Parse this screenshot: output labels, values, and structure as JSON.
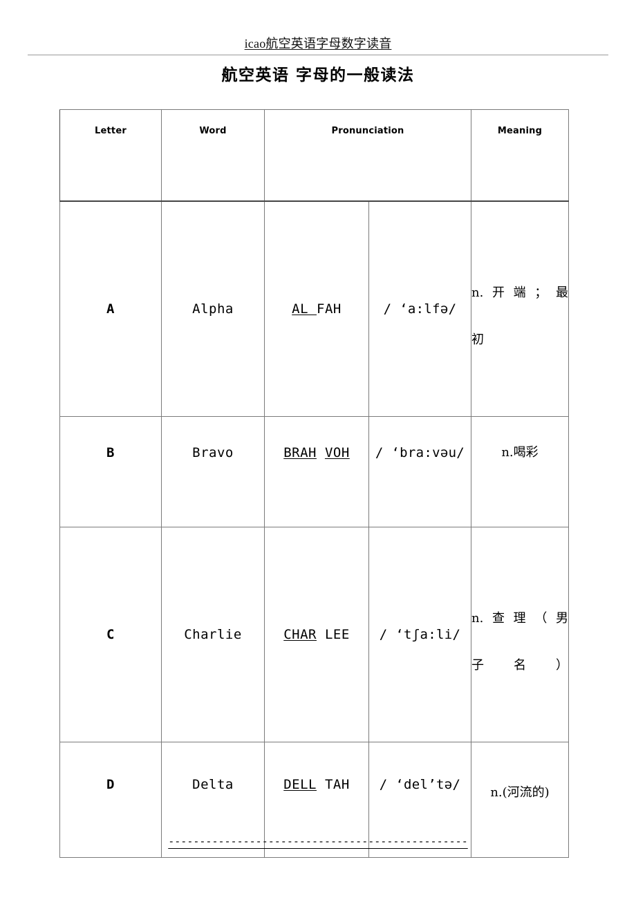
{
  "header": {
    "running_head": "icao航空英语字母数字读音"
  },
  "title": "航空英语 字母的一般读法",
  "table": {
    "columns": [
      {
        "key": "letter",
        "label": "Letter"
      },
      {
        "key": "word",
        "label": "Word"
      },
      {
        "key": "pronunciation",
        "label": "Pronunciation"
      },
      {
        "key": "meaning",
        "label": "Meaning"
      }
    ],
    "rows": [
      {
        "letter": "A",
        "word": "Alpha",
        "respell_underlined": "AL ",
        "respell_plain": "FAH",
        "ipa": "/ ‘a:lfə/",
        "meaning_line1": "n.开端；最",
        "meaning_line2": "初",
        "meaning_full": "n.开端；最初"
      },
      {
        "letter": "B",
        "word": "Bravo",
        "respell_underlined": "BRAH",
        "respell_underlined2": "VOH",
        "respell_plain": "",
        "ipa": "/ ‘bra:vəu/",
        "meaning_line1": "n.喝彩",
        "meaning_line2": "",
        "meaning_full": "n.喝彩"
      },
      {
        "letter": "C",
        "word": "Charlie",
        "respell_underlined": "CHAR",
        "respell_plain": " LEE",
        "ipa": "/ ‘tʃa:li/",
        "meaning_line1": "n.查理（男",
        "meaning_line2": "子名）",
        "meaning_full": "n.查理（男子名）"
      },
      {
        "letter": "D",
        "word": "Delta",
        "respell_underlined": "DELL",
        "respell_plain": " TAH",
        "ipa": "/ ‘del’tə/",
        "meaning_line1": "n.(河流的)",
        "meaning_line2": "",
        "meaning_full": "n.(河流的)"
      }
    ]
  },
  "footer": {
    "separator": "------------------------------------------------"
  }
}
